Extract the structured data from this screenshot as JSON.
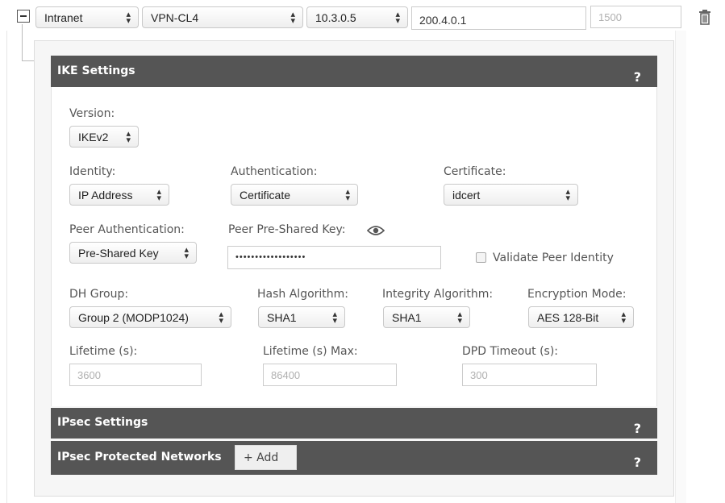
{
  "top_row": {
    "zone": "Intranet",
    "tunnel": "VPN-CL4",
    "local_ip": "10.3.0.5",
    "remote_ip": "200.4.0.1",
    "mtu_placeholder": "1500"
  },
  "ike": {
    "header": "IKE Settings",
    "help": "?",
    "version_label": "Version:",
    "version_value": "IKEv2",
    "identity_label": "Identity:",
    "identity_value": "IP Address",
    "authentication_label": "Authentication:",
    "authentication_value": "Certificate",
    "certificate_label": "Certificate:",
    "certificate_value": "idcert",
    "peer_auth_label": "Peer Authentication:",
    "peer_auth_value": "Pre-Shared Key",
    "peer_psk_label": "Peer Pre-Shared Key:",
    "peer_psk_value": "••••••••••••••••••",
    "validate_label": "Validate Peer Identity",
    "validate_checked": false,
    "dh_label": "DH Group:",
    "dh_value": "Group 2 (MODP1024)",
    "hash_label": "Hash Algorithm:",
    "hash_value": "SHA1",
    "integrity_label": "Integrity Algorithm:",
    "integrity_value": "SHA1",
    "encryption_label": "Encryption Mode:",
    "encryption_value": "AES 128-Bit",
    "lifetime_label": "Lifetime (s):",
    "lifetime_placeholder": "3600",
    "lifetime_max_label": "Lifetime (s) Max:",
    "lifetime_max_placeholder": "86400",
    "dpd_label": "DPD Timeout (s):",
    "dpd_placeholder": "300"
  },
  "ipsec": {
    "header": "IPsec Settings",
    "help": "?"
  },
  "networks": {
    "header": "IPsec Protected Networks",
    "add_label": "+ Add",
    "help": "?"
  },
  "colors": {
    "bar": "#555555",
    "panel": "#f5f5f5"
  }
}
